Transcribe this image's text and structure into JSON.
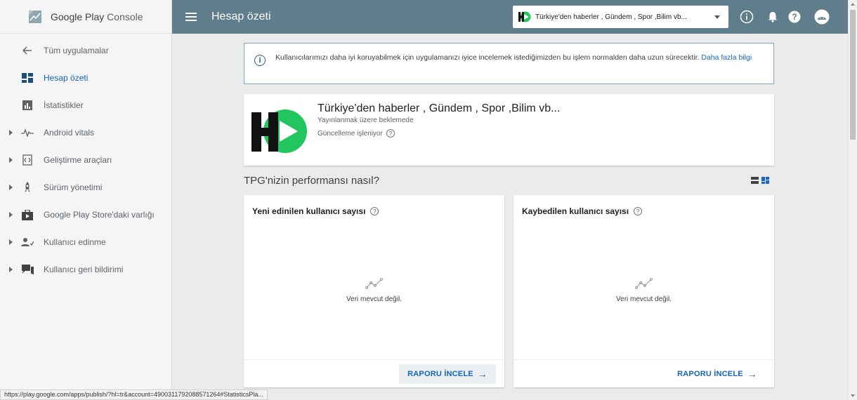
{
  "brand": {
    "name": "Google Play",
    "suffix": "Console"
  },
  "sidebar": {
    "back_label": "Tüm uygulamalar",
    "items": [
      {
        "label": "Hesap özeti",
        "icon": "dashboard-icon",
        "active": true
      },
      {
        "label": "İstatistikler",
        "icon": "bar-chart-icon"
      },
      {
        "label": "Android vitals",
        "icon": "pulse-icon",
        "expandable": true
      },
      {
        "label": "Geliştirme araçları",
        "icon": "dev-tools-icon",
        "expandable": true
      },
      {
        "label": "Sürüm yönetimi",
        "icon": "rocket-icon",
        "expandable": true
      },
      {
        "label": "Google Play Store'daki varlığı",
        "icon": "store-icon",
        "expandable": true
      },
      {
        "label": "Kullanıcı edinme",
        "icon": "user-add-icon",
        "expandable": true
      },
      {
        "label": "Kullanıcı geri bildirimi",
        "icon": "feedback-icon",
        "expandable": true
      }
    ]
  },
  "topbar": {
    "title": "Hesap özeti",
    "app_select": "Türkiye'den haberler , Gündem , Spor ,Bilim vb...",
    "icons": [
      "info-icon",
      "bell-icon",
      "help-icon",
      "account-icon"
    ],
    "color": "#607d8b"
  },
  "notice": {
    "text": "Kullanıcılarımızı daha iyi koruyabilmek için uygulamanızı iyice incelemek istediğimizden bu işlem normalden daha uzun sürecektir. ",
    "link": "Daha fazla bilgi"
  },
  "app": {
    "name": "Türkiye'den haberler , Gündem , Spor ,Bilim vb...",
    "status": "Yayınlanmak üzere beklemede",
    "update": "Güncelleme işleniyor",
    "logo_letter": "H",
    "logo_color": "#22c55e"
  },
  "performance": {
    "title": "TPG'nizin performansı nasıl?",
    "cards": [
      {
        "title": "Yeni edinilen kullanıcı sayısı",
        "empty": "Veri mevcut değil.",
        "button": "RAPORU İNCELE"
      },
      {
        "title": "Kaybedilen kullanıcı sayısı",
        "empty": "Veri mevcut değil.",
        "button": "RAPORU İNCELE"
      }
    ]
  },
  "status_url": "https://play.google.com/apps/publish/?hl=tr&account=4900311792088571264#StatisticsPla..."
}
